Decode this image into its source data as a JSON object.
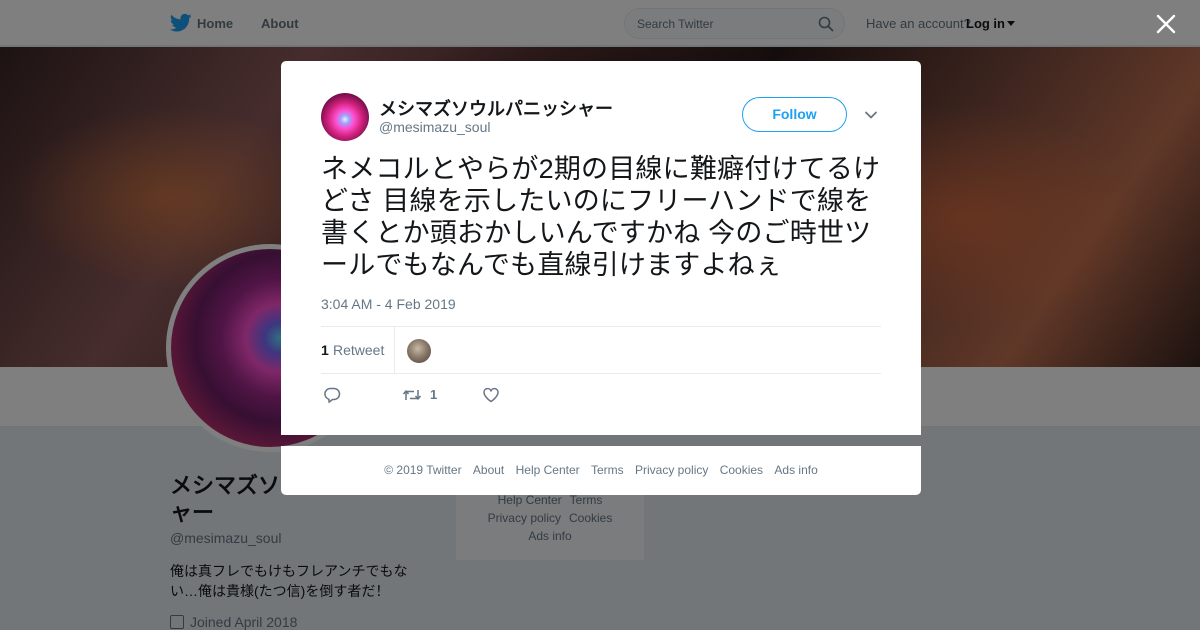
{
  "nav": {
    "home_label": "Home",
    "about_label": "About",
    "search_placeholder": "Search Twitter",
    "account_prompt": "Have an account?",
    "login_label": "Log in"
  },
  "profile": {
    "name": "メシマズソウルパニッシャー",
    "handle": "@mesimazu_soul",
    "bio": "俺は真フレでもけもフレアンチでもない…俺は貴様(たつ信)を倒す者だ！",
    "joined": "Joined April 2018"
  },
  "bg_footer": {
    "row1": [
      "Help Center",
      "Terms"
    ],
    "row2": [
      "Privacy policy",
      "Cookies"
    ],
    "row3": [
      "Ads info"
    ]
  },
  "tweet": {
    "author_name": "メシマズソウルパニッシャー",
    "author_handle": "@mesimazu_soul",
    "follow_label": "Follow",
    "text": "ネメコルとやらが2期の目線に難癖付けてるけどさ 目線を示したいのにフリーハンドで線を書くとか頭おかしいんですかね 今のご時世ツールでもなんでも直線引けますよねぇ",
    "timestamp": "3:04 AM - 4 Feb 2019",
    "retweet_count": "1",
    "retweet_label": "Retweet",
    "action_retweet_count": "1"
  },
  "footer": {
    "copyright": "© 2019 Twitter",
    "links": [
      "About",
      "Help Center",
      "Terms",
      "Privacy policy",
      "Cookies",
      "Ads info"
    ]
  },
  "colors": {
    "accent": "#1da1f2",
    "muted_text": "#657786",
    "overlay": "rgba(0,0,0,0.5)"
  },
  "icons": [
    "twitter-bird-icon",
    "search-icon",
    "caret-down-icon",
    "close-icon",
    "chevron-down-icon",
    "reply-icon",
    "retweet-icon",
    "like-icon",
    "calendar-icon"
  ]
}
